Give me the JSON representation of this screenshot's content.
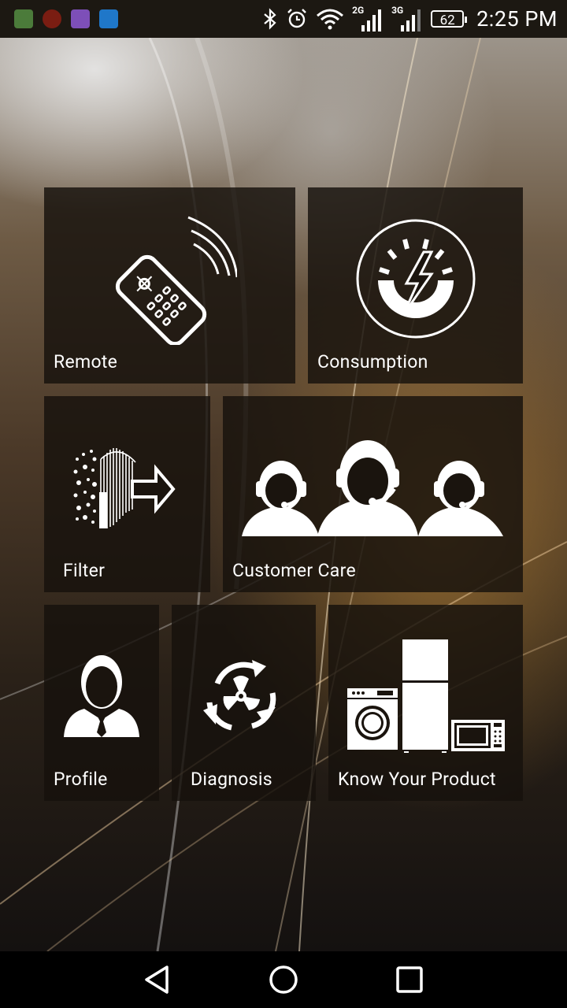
{
  "status_bar": {
    "time": "2:25 PM",
    "battery": "62",
    "network_2g": "2G",
    "network_3g": "3G",
    "icons": [
      "bluetooth-icon",
      "alarm-icon",
      "wifi-icon",
      "signal-2g-icon",
      "signal-3g-icon",
      "battery-icon"
    ],
    "notification_apps": [
      "app-notification-1",
      "app-notification-2",
      "app-notification-3",
      "app-notification-4"
    ]
  },
  "tiles": [
    {
      "label": "Remote",
      "icon": "remote-control-icon"
    },
    {
      "label": "Consumption",
      "icon": "energy-consumption-icon"
    },
    {
      "label": "Filter",
      "icon": "air-filter-icon"
    },
    {
      "label": "Customer Care",
      "icon": "customer-care-agents-icon"
    },
    {
      "label": "Profile",
      "icon": "user-profile-icon"
    },
    {
      "label": "Diagnosis",
      "icon": "diagnosis-fan-icon"
    },
    {
      "label": "Know Your Product",
      "icon": "appliances-icon"
    }
  ],
  "nav_bar": {
    "buttons": [
      "back-icon",
      "home-icon",
      "recents-icon"
    ]
  },
  "colors": {
    "tile_bg": "#16110c",
    "status_bar_bg": "#1c1812",
    "nav_bar_bg": "#000000",
    "text": "#ffffff"
  }
}
